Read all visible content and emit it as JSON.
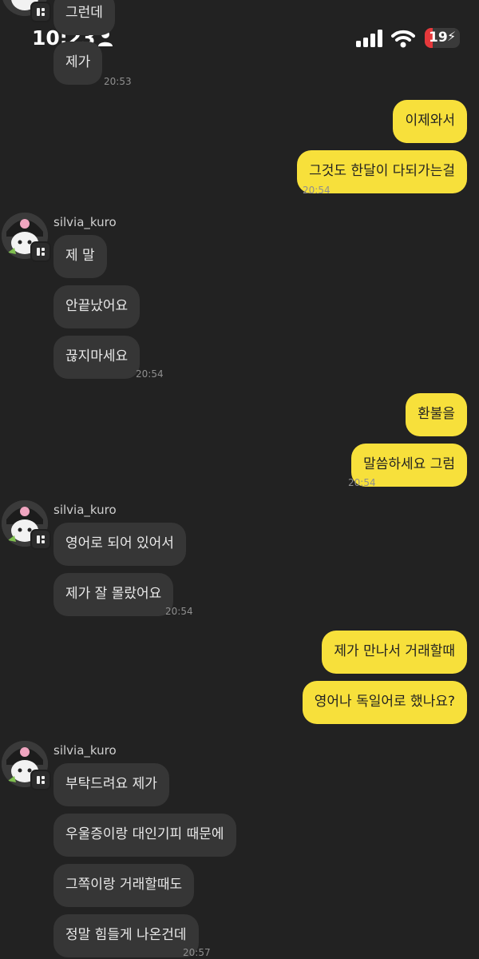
{
  "status": {
    "time": "10:23",
    "battery": "19"
  },
  "messages": {
    "m0": "그런데",
    "m1": "제가",
    "t1": "20:53",
    "o1": "이제와서",
    "o2": "그것도 한달이 다되가는걸",
    "t2": "20:54",
    "sender": "silvia_kuro",
    "g2a": "제 말",
    "g2b": "안끝났어요",
    "g2c": "끊지마세요",
    "t3": "20:54",
    "o3": "환불을",
    "o4": "말씀하세요 그럼",
    "t4": "20:54",
    "g3a": "영어로 되어 있어서",
    "g3b": "제가 잘 몰랐어요",
    "t5": "20:54",
    "o5": "제가 만나서 거래할때",
    "o6": "영어나 독일어로 했나요?",
    "g4a": "부탁드려요 제가",
    "g4b": "우울증이랑 대인기피 때문에",
    "g4c": "그쪽이랑 거래할때도",
    "g4d": "정말 힘들게 나온건데",
    "t6": "20:57"
  },
  "colors": {
    "background": "#222222",
    "incoming_bubble": "#363636",
    "outgoing_bubble": "#f7e03b",
    "battery_low": "#e5383b"
  },
  "icons": {
    "avatar": "kuromi-avatar-icon",
    "person": "person-icon",
    "signal": "signal-bars-icon",
    "wifi": "wifi-icon",
    "battery": "battery-charging-icon"
  }
}
